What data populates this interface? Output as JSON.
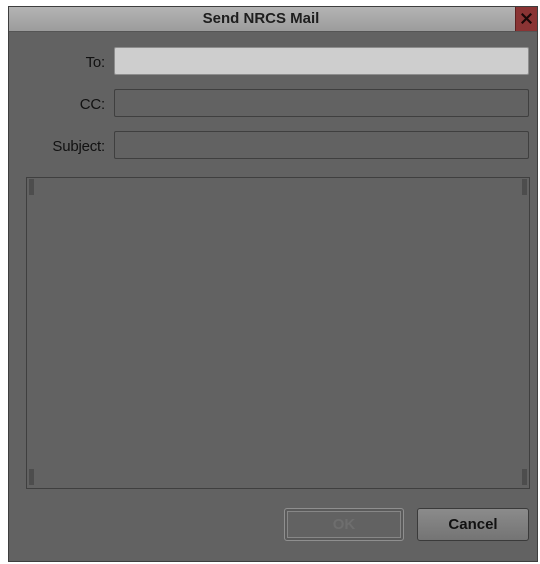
{
  "window": {
    "title": "Send NRCS Mail",
    "close_icon": "close-x-icon",
    "close_color": "#8a3434"
  },
  "form": {
    "to": {
      "label": "To:",
      "value": ""
    },
    "cc": {
      "label": "CC:",
      "value": ""
    },
    "subject": {
      "label": "Subject:",
      "value": ""
    },
    "message_body": ""
  },
  "buttons": {
    "ok_label": "OK",
    "ok_enabled": false,
    "cancel_label": "Cancel"
  }
}
